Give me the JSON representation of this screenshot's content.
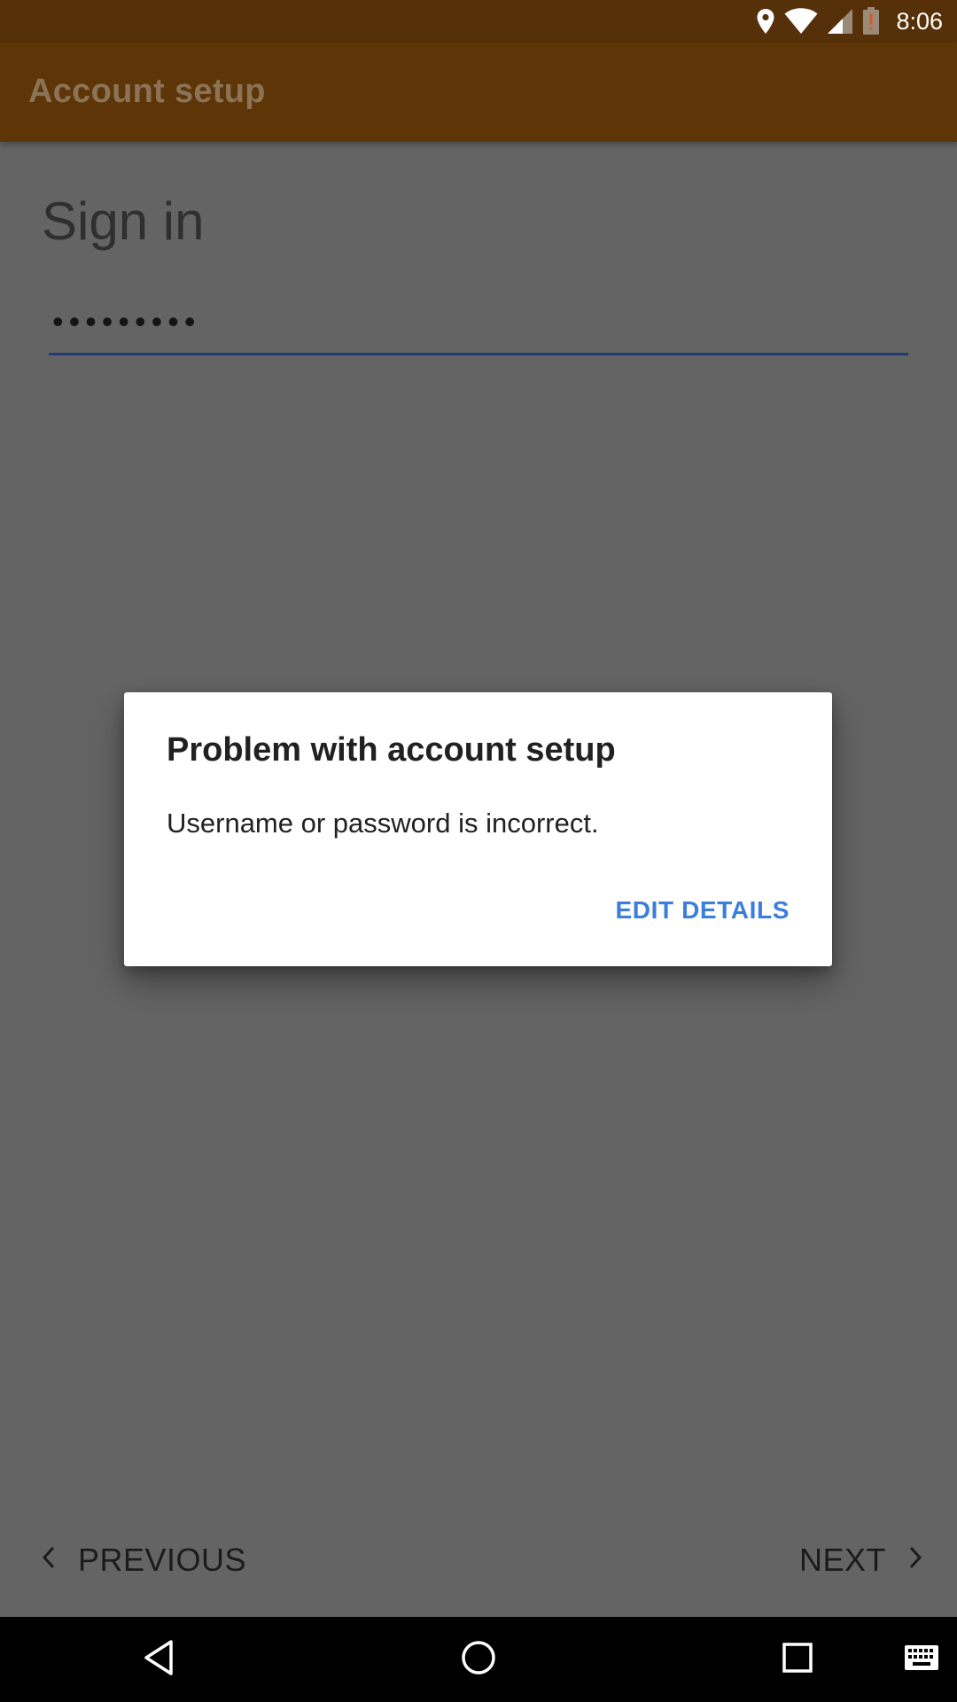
{
  "status_bar": {
    "time": "8:06",
    "icons": [
      "location-icon",
      "wifi-icon",
      "cell-signal-icon",
      "battery-alert-icon"
    ]
  },
  "app_bar": {
    "title": "Account setup"
  },
  "form": {
    "heading": "Sign in",
    "password_value": "•••••••••"
  },
  "wizard_nav": {
    "previous_label": "PREVIOUS",
    "next_label": "NEXT"
  },
  "dialog": {
    "title": "Problem with account setup",
    "message": "Username or password is incorrect.",
    "action_label": "EDIT DETAILS"
  },
  "system_nav": {
    "icons": [
      "back-icon",
      "home-icon",
      "recents-icon",
      "keyboard-icon"
    ]
  },
  "colors": {
    "status_bar": "#563008",
    "app_bar": "#5e3507",
    "scrim_background": "#646464",
    "field_underline": "#1f3d73",
    "dialog_action": "#3b7edb"
  }
}
